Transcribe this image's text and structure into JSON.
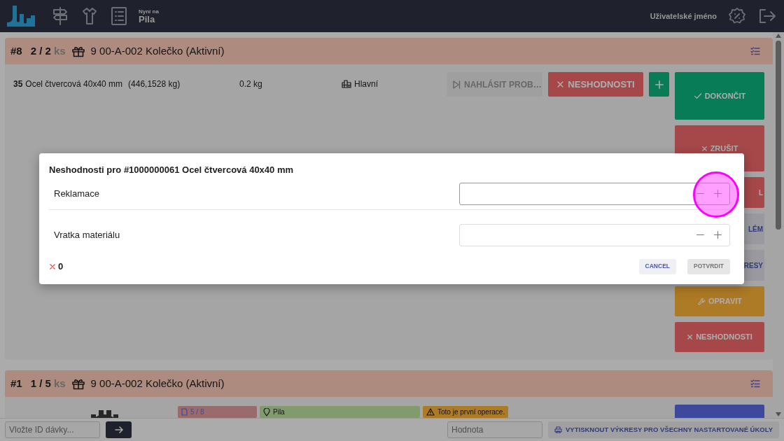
{
  "navbar": {
    "location_label": "Nyní na",
    "location": "Pila",
    "user": "Uživatelské jméno"
  },
  "tasks": [
    {
      "number": "#8",
      "count": "2 / 2",
      "unit": "ks",
      "product": "9 00-A-002 Kolečko (Aktivní)",
      "materials": [
        {
          "quantity": "35",
          "name": "Ocel čtvercová 40x40 mm",
          "stock": "(446,1528 kg)",
          "per_unit": "0.2 kg",
          "storage": "Hlavní"
        }
      ],
      "row_buttons": [
        {
          "kind": "report",
          "label": "NAHLÁSIT PROB…",
          "disabled": true
        },
        {
          "kind": "danger",
          "label": "NESHODNOSTI"
        },
        {
          "kind": "add"
        }
      ],
      "actions": [
        {
          "kind": "success",
          "label": "DOKONČIT"
        },
        {
          "kind": "danger",
          "label": "ZRUŠIT"
        },
        {
          "kind": "danger",
          "label": "L",
          "clipped": true
        },
        {
          "kind": "secondary",
          "label": "LÉM",
          "clipped": true
        },
        {
          "kind": "secondary",
          "label": "RESY",
          "clipped": true
        },
        {
          "kind": "warning",
          "label": "OPRAVIT"
        },
        {
          "kind": "danger",
          "label": "NESHODNOSTI"
        }
      ]
    },
    {
      "number": "#1",
      "count": "1 / 5",
      "unit": "ks",
      "product": "9 00-A-002 Kolečko (Aktivní)",
      "picture": {
        "kind": "picture"
      },
      "tags": [
        {
          "kind": "drawings",
          "text": "5 / 8"
        },
        {
          "kind": "location",
          "text": "Pila"
        },
        {
          "kind": "warning",
          "text": "Toto je první operace."
        }
      ],
      "actions": [
        {
          "kind": "primary"
        }
      ]
    }
  ],
  "bottom_bar": {
    "batch_placeholder": "Vložte ID dávky...",
    "value_placeholder": "Hodnota",
    "print_label": "VYTISKNOUT VÝKRESY PRO VŠECHNY NASTARTOVANÉ ÚKOLY"
  },
  "modal": {
    "title": "Neshodnosti pro #1000000061 Ocel čtvercová 40x40 mm",
    "fields": [
      {
        "label": "Reklamace",
        "focused": true
      },
      {
        "label": "Vratka materiálu",
        "focused": false
      }
    ],
    "total": "0",
    "buttons": [
      {
        "kind": "cancel",
        "label": "CANCEL"
      },
      {
        "kind": "confirm",
        "label": "POTVRDIT",
        "disabled": true
      }
    ]
  }
}
